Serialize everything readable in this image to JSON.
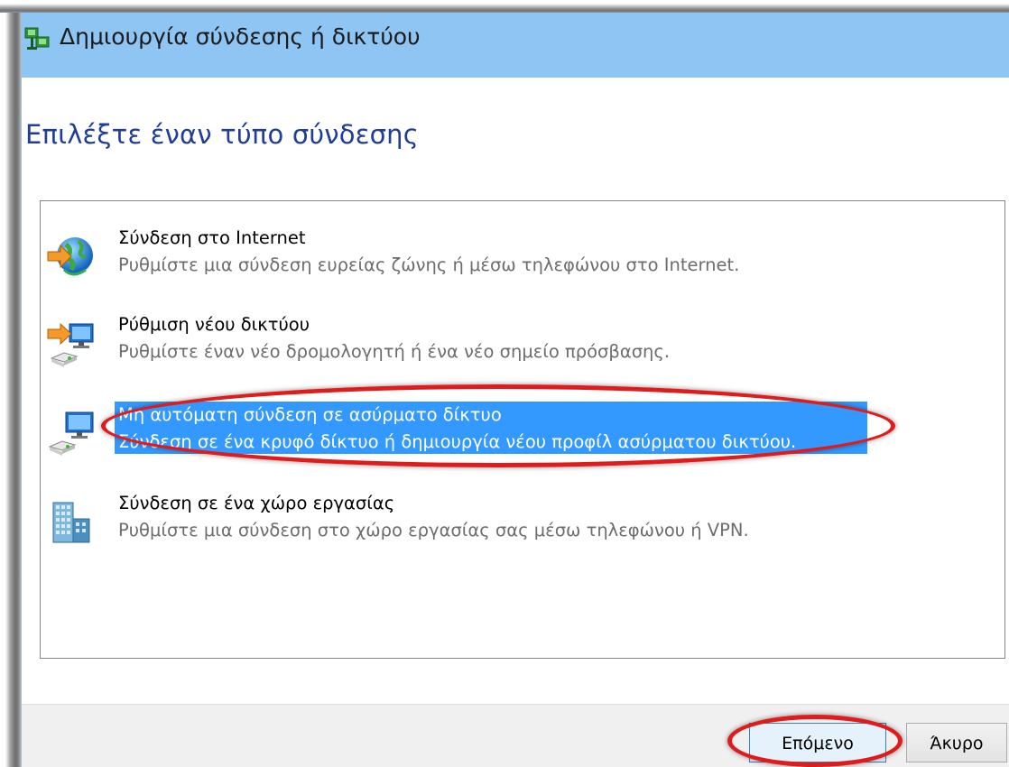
{
  "window": {
    "title": "Δημιουργία σύνδεσης ή δικτύου",
    "title_icon": "network-connection-icon"
  },
  "heading": "Επιλέξτε έναν τύπο σύνδεσης",
  "options": [
    {
      "title": "Σύνδεση στο Internet",
      "description": "Ρυθμίστε μια σύνδεση ευρείας ζώνης ή μέσω τηλεφώνου στο Internet.",
      "icon": "globe-internet-icon",
      "selected": false
    },
    {
      "title": "Ρύθμιση νέου δικτύου",
      "description": "Ρυθμίστε έναν νέο δρομολογητή ή ένα νέο σημείο πρόσβασης.",
      "icon": "new-network-router-icon",
      "selected": false
    },
    {
      "title": "Μη αυτόματη σύνδεση σε ασύρματο δίκτυο",
      "description": "Σύνδεση σε ένα κρυφό δίκτυο ή δημιουργία νέου προφίλ ασύρματου δικτύου.",
      "icon": "wireless-network-icon",
      "selected": true
    },
    {
      "title": "Σύνδεση σε ένα χώρο εργασίας",
      "description": "Ρυθμίστε μια σύνδεση στο χώρο εργασίας σας μέσω τηλεφώνου ή VPN.",
      "icon": "workplace-vpn-icon",
      "selected": false
    }
  ],
  "buttons": {
    "next": "Επόμενο",
    "cancel": "Άκυρο"
  },
  "colors": {
    "titlebar": "#8ec5f3",
    "heading": "#1f3d99",
    "selection": "#3399ff",
    "highlight_ring": "#e01b1b"
  }
}
